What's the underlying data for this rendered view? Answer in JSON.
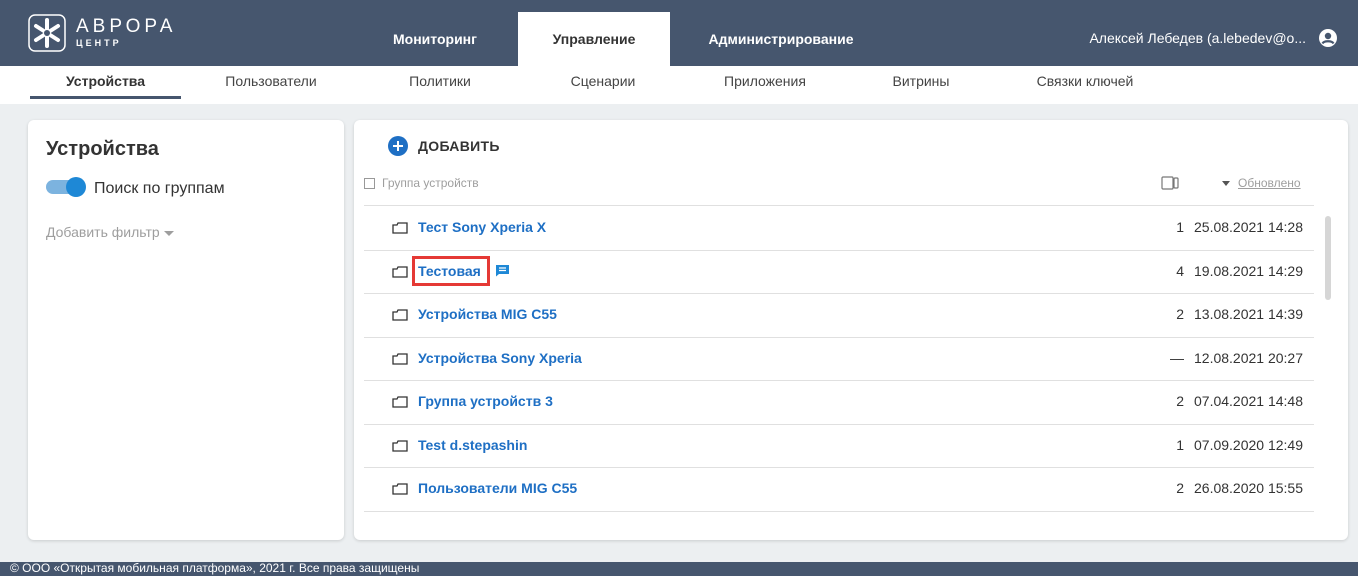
{
  "app": {
    "logo_title": "АВРОРА",
    "logo_sub": "ЦЕНТР",
    "user_label": "Алексей Лебедев (a.lebedev@o..."
  },
  "main_tabs": [
    {
      "label": "Мониторинг",
      "active": false
    },
    {
      "label": "Управление",
      "active": true
    },
    {
      "label": "Администрирование",
      "active": false
    }
  ],
  "sub_tabs": [
    {
      "label": "Устройства",
      "active": true
    },
    {
      "label": "Пользователи",
      "active": false
    },
    {
      "label": "Политики",
      "active": false
    },
    {
      "label": "Сценарии",
      "active": false
    },
    {
      "label": "Приложения",
      "active": false
    },
    {
      "label": "Витрины",
      "active": false
    },
    {
      "label": "Связки ключей",
      "active": false
    }
  ],
  "filter_panel": {
    "title": "Устройства",
    "toggle_label": "Поиск по группам",
    "toggle_on": true,
    "add_filter_label": "Добавить фильтр"
  },
  "list_panel": {
    "add_label": "ДОБАВИТЬ",
    "header_group_label": "Группа устройств",
    "header_sort_label": "Обновлено",
    "rows": [
      {
        "name": "Тест Sony Xperia X",
        "count": "1",
        "date": "25.08.2021 14:28"
      },
      {
        "name": "Тестовая",
        "count": "4",
        "date": "19.08.2021 14:29",
        "has_comment": true,
        "highlighted": true
      },
      {
        "name": "Устройства MIG C55",
        "count": "2",
        "date": "13.08.2021 14:39"
      },
      {
        "name": "Устройства Sony Xperia",
        "count": "—",
        "date": "12.08.2021 20:27"
      },
      {
        "name": "Группа устройств 3",
        "count": "2",
        "date": "07.04.2021 14:48"
      },
      {
        "name": "Test d.stepashin",
        "count": "1",
        "date": "07.09.2020 12:49"
      },
      {
        "name": "Пользователи MIG C55",
        "count": "2",
        "date": "26.08.2020 15:55"
      }
    ]
  },
  "footer": {
    "text": "© ООО «Открытая мобильная платформа», 2021 г. Все права защищены"
  },
  "colors": {
    "topbar": "#46566e",
    "accent": "#1e6fc4",
    "highlight": "#e53935"
  }
}
